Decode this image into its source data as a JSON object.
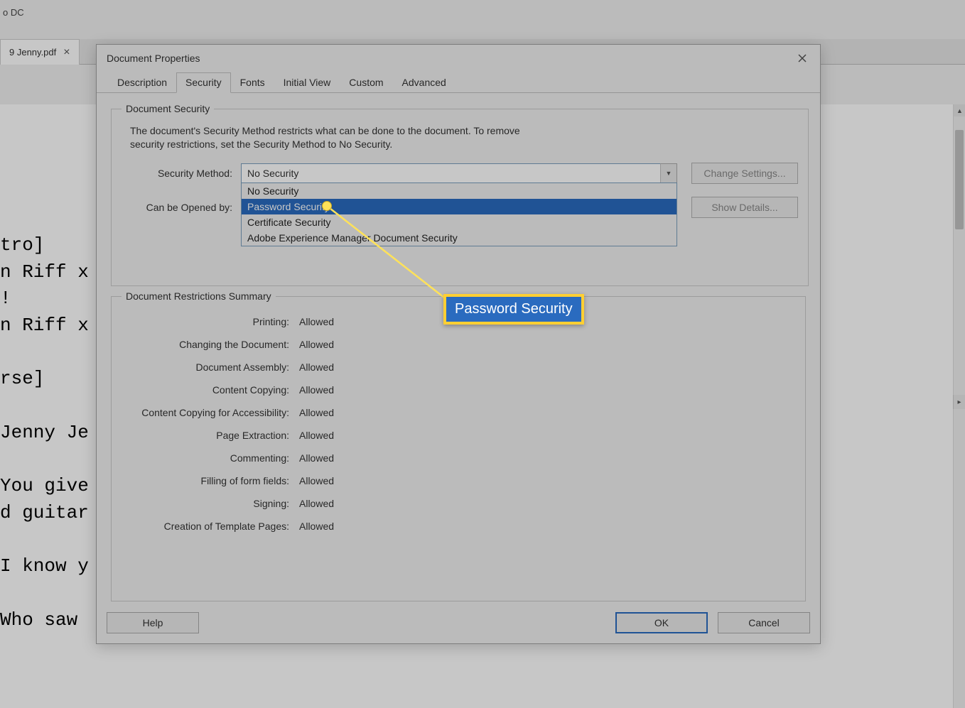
{
  "app_title": "o DC",
  "tab": {
    "name": "9 Jenny.pdf",
    "close_glyph": "×"
  },
  "page_text": "tro]\nn Riff x\n!\nn Riff x\n\nrse]\n          D\nJenny Je\n\nYou give\nd guitar\n\nI know y\n\nWho saw",
  "dialog": {
    "title": "Document Properties",
    "tabs": [
      "Description",
      "Security",
      "Fonts",
      "Initial View",
      "Custom",
      "Advanced"
    ],
    "active_tab": 1,
    "security_legend": "Document Security",
    "help_text": "The document's Security Method restricts what can be done to the document. To remove security restrictions, set the Security Method to No Security.",
    "security_method_label": "Security Method:",
    "security_method_value": "No Security",
    "security_options": [
      "No Security",
      "Password Security",
      "Certificate Security",
      "Adobe Experience Manager Document Security"
    ],
    "selected_option_index": 1,
    "opened_by_label": "Can be Opened by:",
    "change_settings": "Change Settings...",
    "show_details": "Show Details...",
    "restrictions_legend": "Document Restrictions Summary",
    "restrictions": [
      {
        "label": "Printing:",
        "value": "Allowed"
      },
      {
        "label": "Changing the Document:",
        "value": "Allowed"
      },
      {
        "label": "Document Assembly:",
        "value": "Allowed"
      },
      {
        "label": "Content Copying:",
        "value": "Allowed"
      },
      {
        "label": "Content Copying for Accessibility:",
        "value": "Allowed"
      },
      {
        "label": "Page Extraction:",
        "value": "Allowed"
      },
      {
        "label": "Commenting:",
        "value": "Allowed"
      },
      {
        "label": "Filling of form fields:",
        "value": "Allowed"
      },
      {
        "label": "Signing:",
        "value": "Allowed"
      },
      {
        "label": "Creation of Template Pages:",
        "value": "Allowed"
      }
    ],
    "buttons": {
      "help": "Help",
      "ok": "OK",
      "cancel": "Cancel"
    }
  },
  "callout_text": "Password Security"
}
